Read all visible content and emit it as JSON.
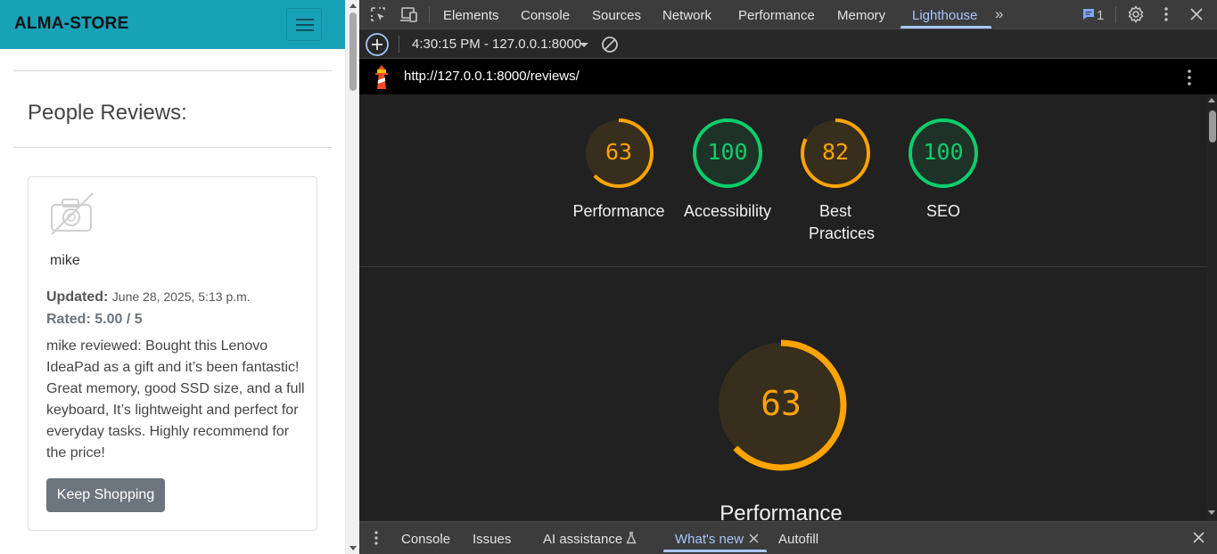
{
  "site": {
    "brand": "ALMA-STORE",
    "heading": "People Reviews:",
    "review": {
      "name": "mike",
      "updated_label": "Updated:",
      "updated_date": "June 28, 2025, 5:13 p.m.",
      "rated": "Rated: 5.00 / 5",
      "text": "mike reviewed: Bought this Lenovo IdeaPad as a gift and it’s been fantastic! Great memory, good SSD size, and a full keyboard, It’s lightweight and perfect for everyday tasks. Highly recommend for the price!",
      "button": "Keep Shopping"
    },
    "colors": {
      "navbar": "#17a2b8",
      "button": "#6c757d"
    }
  },
  "devtools": {
    "tabs": [
      "Elements",
      "Console",
      "Sources",
      "Network",
      "Performance",
      "Memory",
      "Lighthouse"
    ],
    "active_tab": "Lighthouse",
    "issues_count": "1",
    "report_select": "4:30:15 PM - 127.0.0.1:8000",
    "url": "http://127.0.0.1:8000/reviews/",
    "scores": [
      {
        "label": "Performance",
        "value": "63",
        "score": 0.63,
        "color": "#ffa400"
      },
      {
        "label": "Accessibility",
        "value": "100",
        "score": 1.0,
        "color": "#0cce6b"
      },
      {
        "label": "Best Practices",
        "value": "82",
        "score": 0.82,
        "color": "#ffa400"
      },
      {
        "label": "SEO",
        "value": "100",
        "score": 1.0,
        "color": "#0cce6b"
      }
    ],
    "detail": {
      "value": "63",
      "score": 0.63,
      "title": "Performance",
      "color": "#ffa400"
    },
    "drawer_tabs": [
      "Console",
      "Issues",
      "AI assistance",
      "What's new",
      "Autofill"
    ],
    "drawer_active": "What's new"
  }
}
